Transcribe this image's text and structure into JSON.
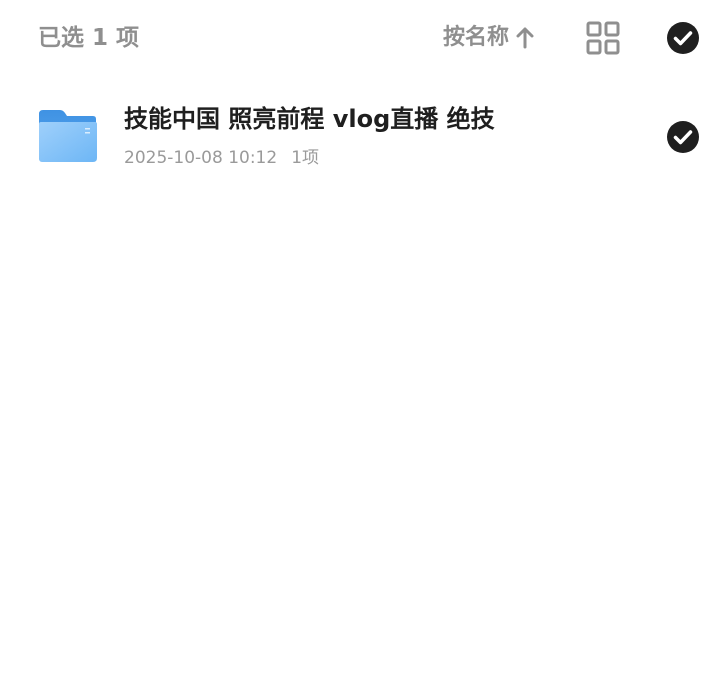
{
  "header": {
    "selected_text": "已选 1 项",
    "sort_label": "按名称",
    "sort_direction_icon": "arrow-up-icon",
    "view_toggle_icon": "grid-view-icon",
    "select_all_icon": "check-circle-icon",
    "select_all_checked": true
  },
  "files": [
    {
      "name": "技能中国 照亮前程 vlog直播 绝技",
      "date": "2025-10-08 10:12",
      "count": "1项",
      "icon": "folder-icon",
      "selected": true
    }
  ],
  "colors": {
    "header_text": "#8f8f8f",
    "title_text": "#1f1f1f",
    "meta_text": "#9a9a9a",
    "check_fill": "#1f1f1f",
    "folder_blue": "#5aa8ef"
  }
}
